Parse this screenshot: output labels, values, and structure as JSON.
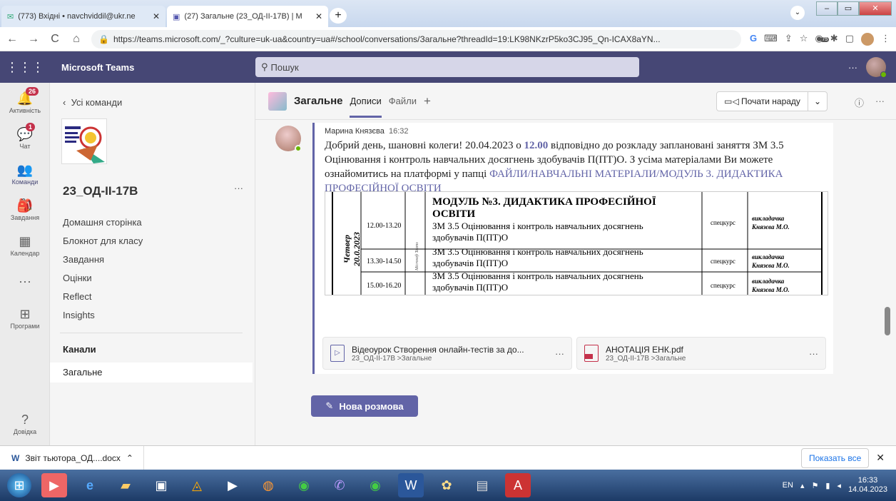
{
  "browser": {
    "tabs": [
      {
        "title": "(773) Вхідні • navchviddil@ukr.ne",
        "close": "✕"
      },
      {
        "title": "(27) Загальне (23_ОД-ІІ-17В) | М",
        "close": "✕"
      }
    ],
    "new_tab": "+",
    "url": "https://teams.microsoft.com/_?culture=uk-ua&country=ua#/school/conversations/Загальне?threadId=19:LK98NKzrP5ko3CJ95_Qn-ICAX8aYN...",
    "ext_badge": "75"
  },
  "teams": {
    "app_name": "Microsoft Teams",
    "search_placeholder": "Пошук",
    "more": "···"
  },
  "rail": [
    {
      "label": "Активність",
      "badge": "26"
    },
    {
      "label": "Чат",
      "badge": "1"
    },
    {
      "label": "Команди",
      "badge": ""
    },
    {
      "label": "Завдання",
      "badge": ""
    },
    {
      "label": "Календар",
      "badge": ""
    },
    {
      "label": "···",
      "badge": ""
    },
    {
      "label": "Програми",
      "badge": ""
    },
    {
      "label": "Довідка",
      "badge": ""
    }
  ],
  "team_panel": {
    "back": "Усі команди",
    "team_name": "23_ОД-ІІ-17В",
    "more": "···",
    "nav": [
      "Домашня сторінка",
      "Блокнот для класу",
      "Завдання",
      "Оцінки",
      "Reflect",
      "Insights"
    ],
    "channels_header": "Канали",
    "channel": "Загальне"
  },
  "channel_header": {
    "name": "Загальне",
    "tabs": [
      "Дописи",
      "Файли"
    ],
    "add": "+",
    "meet_button": "Почати нараду",
    "info": "ⓘ",
    "more": "···"
  },
  "post": {
    "author": "Марина Князєва",
    "time": "16:32",
    "text_1": "Добрий день, шановні колеги! 20.04.2023 о ",
    "text_time": "12.00",
    "text_2": " відповідно до розкладу заплановані заняття ЗМ 3.5 Оцінювання і контроль навчальних досягнень здобувачів П(ПТ)О. З усіма матеріалами Ви можете ознайомитись на платформі у папці ",
    "text_link": "ФАЙЛИ/НАВЧАЛЬНІ МАТЕРІАЛИ/МОДУЛЬ 3. ДИДАКТИКА ПРОФЕСІЙНОЇ ОСВІТИ"
  },
  "schedule": {
    "day": "Четвер",
    "date": "20.0.2023",
    "platform": "Microsoft Teams",
    "module": "МОДУЛЬ №3. ДИДАКТИКА ПРОФЕСІЙНОЇ ОСВІТИ",
    "rows": [
      {
        "time": "12.00-13.20",
        "subject": "ЗМ 3.5 Оцінювання і контроль навчальних досягнень здобувачів П(ПТ)О",
        "type": "спецкурс",
        "teacher": "викладачка Князєва М.О."
      },
      {
        "time": "13.30-14.50",
        "subject": "ЗМ 3.5 Оцінювання і контроль навчальних досягнень здобувачів П(ПТ)О",
        "type": "спецкурс",
        "teacher": "викладачка Князєва М.О."
      },
      {
        "time": "15.00-16.20",
        "subject": "ЗМ 3.5 Оцінювання і контроль навчальних досягнень здобувачів П(ПТ)О",
        "type": "спецкурс",
        "teacher": "викладачка Князєва М.О."
      }
    ]
  },
  "attachments": [
    {
      "name": "Відеоурок Створення онлайн-тестів за до...",
      "path": "23_ОД-ІІ-17В >Загальне",
      "more": "···"
    },
    {
      "name": "АНОТАЦІЯ ЕНК.pdf",
      "path": "23_ОД-ІІ-17В >Загальне",
      "more": "···"
    }
  ],
  "new_conversation": "Нова розмова",
  "downloads": {
    "file": "Звіт тьютора_ОД....docx",
    "show_all": "Показать все",
    "close": "✕"
  },
  "taskbar": {
    "lang": "EN",
    "time": "16:33",
    "date": "14.04.2023"
  },
  "colors": {
    "teams_purple": "#464775",
    "accent": "#6264a7",
    "badge_red": "#c4314b"
  }
}
